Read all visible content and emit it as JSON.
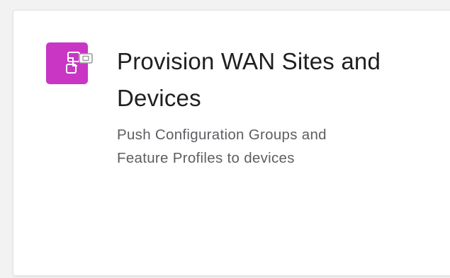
{
  "card": {
    "title": "Provision WAN Sites and Devices",
    "description_line1": "Push Configuration Groups and",
    "description_line2": "Feature Profiles to devices",
    "icon": "provision-devices-icon",
    "accent_color": "#c936c4"
  }
}
